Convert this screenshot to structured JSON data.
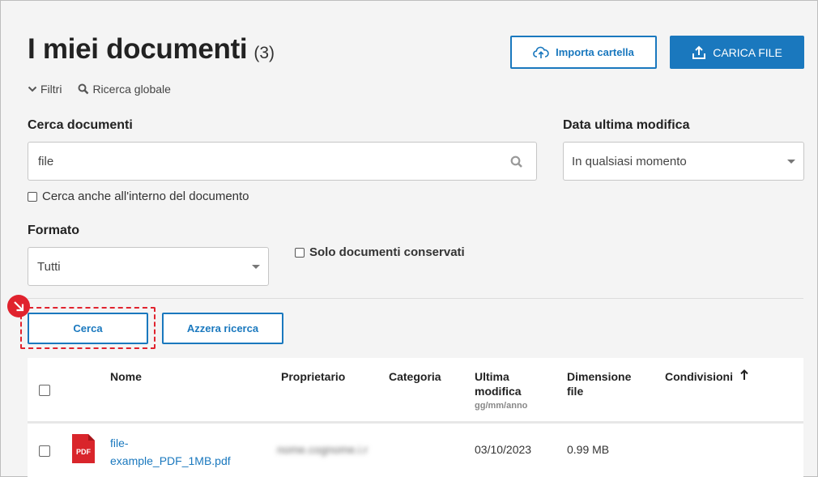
{
  "header": {
    "title": "I miei documenti",
    "count": "(3)",
    "import_label": "Importa cartella",
    "upload_label": "CARICA FILE"
  },
  "filters_bar": {
    "filters_label": "Filtri",
    "global_search_label": "Ricerca globale"
  },
  "search": {
    "label": "Cerca documenti",
    "value": "file",
    "inside_doc_label": "Cerca anche all'interno del documento"
  },
  "date_filter": {
    "label": "Data ultima modifica",
    "selected": "In qualsiasi momento"
  },
  "format_filter": {
    "label": "Formato",
    "selected": "Tutti"
  },
  "preserved": {
    "label": "Solo documenti conservati"
  },
  "actions": {
    "search_label": "Cerca",
    "reset_label": "Azzera ricerca"
  },
  "table": {
    "columns": {
      "name": "Nome",
      "owner": "Proprietario",
      "category": "Categoria",
      "modified": "Ultima modifica",
      "modified_sub": "gg/mm/anno",
      "size": "Dimensione file",
      "shares": "Condivisioni"
    },
    "rows": [
      {
        "icon_label": "PDF",
        "name": "file-example_PDF_1MB.pdf",
        "owner": "nome.cognome.i.r",
        "category": "",
        "modified": "03/10/2023",
        "size": "0.99 MB",
        "shares": ""
      }
    ]
  },
  "colors": {
    "accent": "#1a78be",
    "highlight": "#e0232e",
    "pdf_red": "#d9252b"
  }
}
